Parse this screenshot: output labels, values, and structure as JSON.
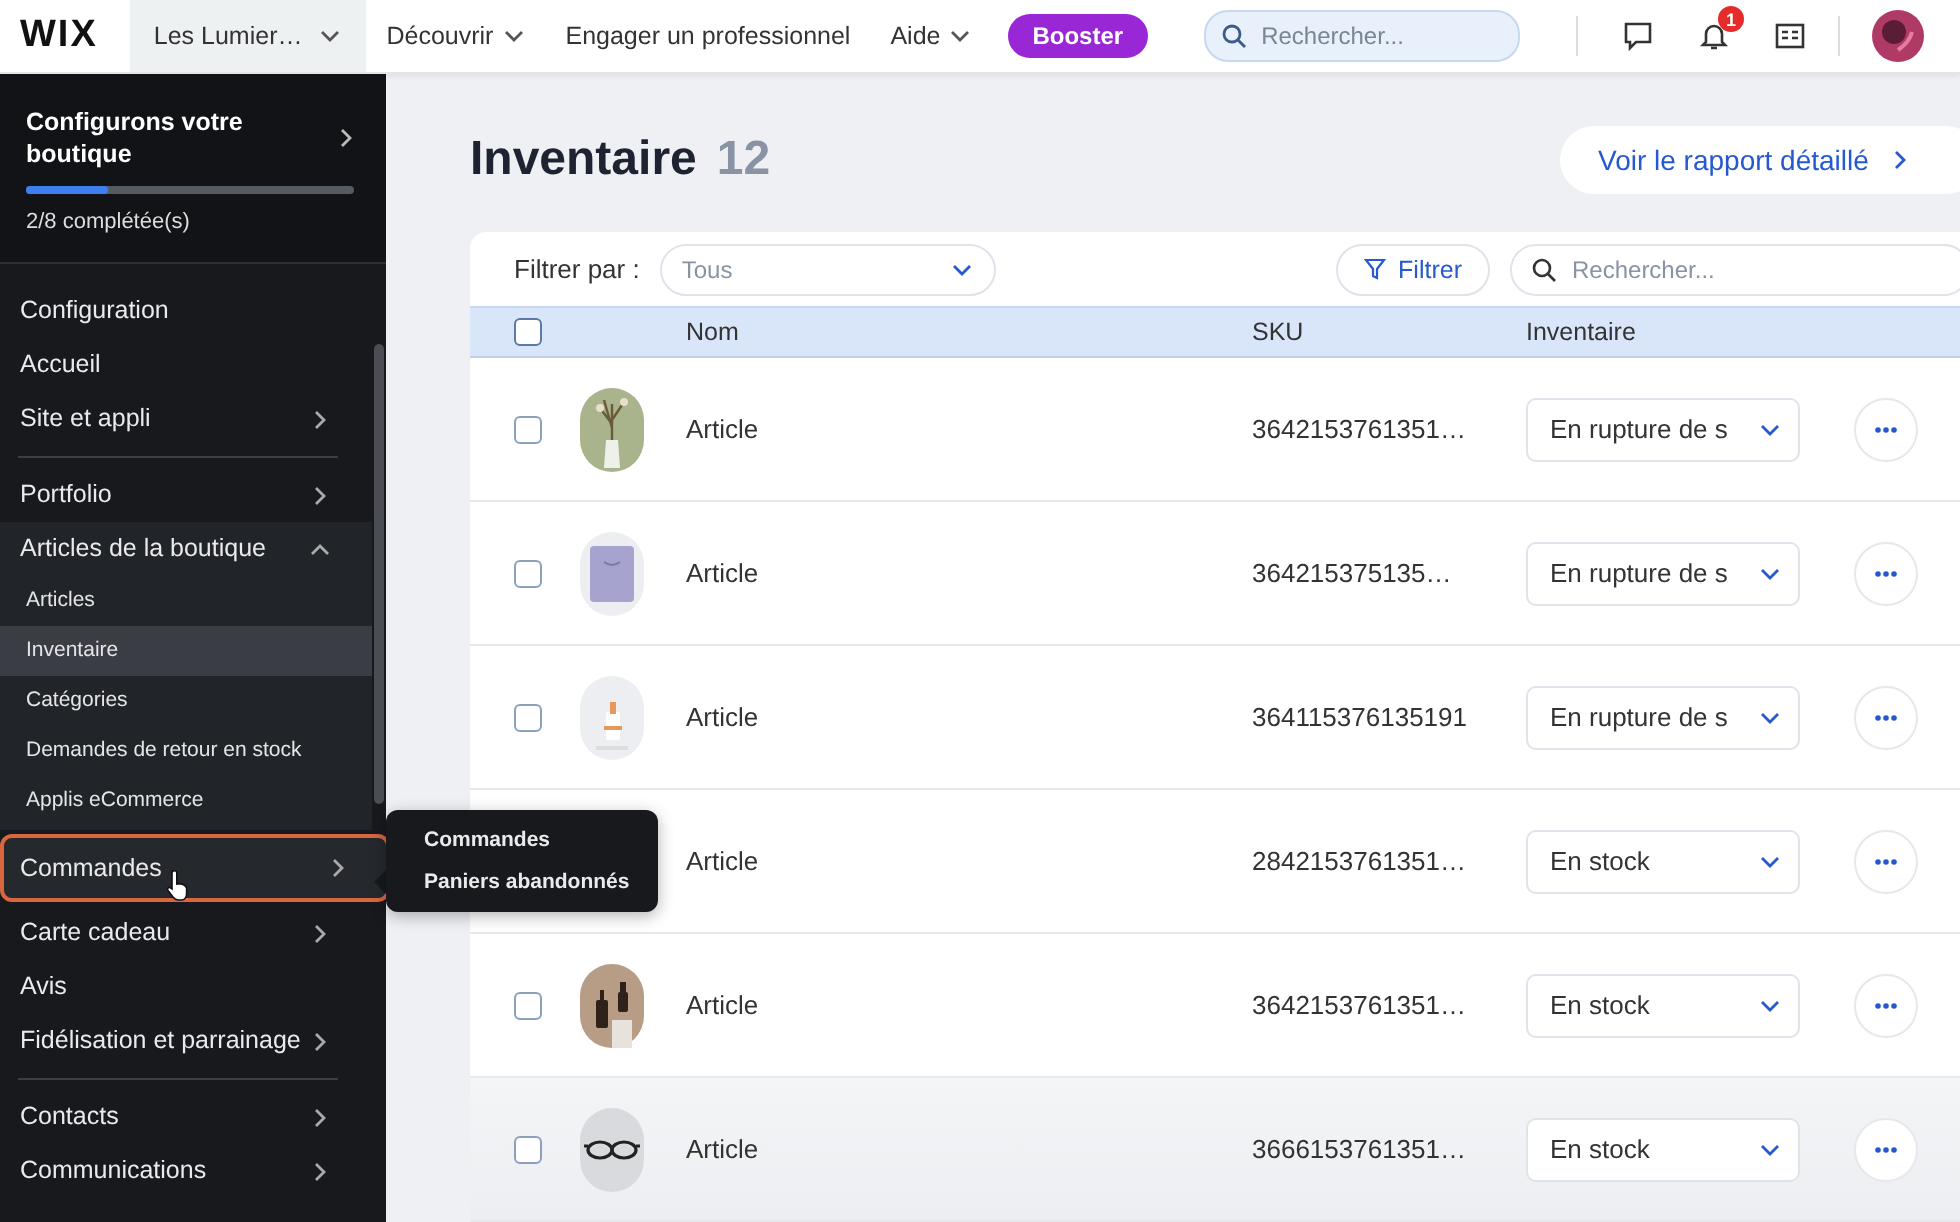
{
  "topbar": {
    "logo": "WIX",
    "site": "Les Lumier…",
    "nav": [
      {
        "label": "Découvrir",
        "caret": true
      },
      {
        "label": "Engager un professionnel",
        "caret": false
      },
      {
        "label": "Aide",
        "caret": true
      }
    ],
    "upgrade": "Booster",
    "search": {
      "placeholder": "Rechercher..."
    },
    "notifications": "1"
  },
  "sidebar": {
    "setup": {
      "title": "Configurons votre boutique",
      "level": 0.25,
      "progress": "2/8 complétée(s)"
    },
    "items": [
      {
        "label": "Configuration",
        "has_submenu": false,
        "divider_after": false,
        "highlighted": false
      },
      {
        "label": "Accueil",
        "has_submenu": false,
        "divider_after": false,
        "highlighted": false
      },
      {
        "label": "Site et appli",
        "has_submenu": true,
        "expanded": false,
        "divider_after": true,
        "highlighted": false
      },
      {
        "label": "Portfolio",
        "has_submenu": true,
        "expanded": false,
        "divider_after": false,
        "highlighted": false
      },
      {
        "label": "Articles de la boutique",
        "has_submenu": true,
        "expanded": true,
        "divider_after": false,
        "highlighted": false,
        "children": [
          {
            "label": "Articles",
            "selected": false
          },
          {
            "label": "Inventaire",
            "selected": true
          },
          {
            "label": "Catégories",
            "selected": false
          },
          {
            "label": "Demandes de retour en stock",
            "selected": false
          },
          {
            "label": "Applis eCommerce",
            "selected": false
          }
        ]
      },
      {
        "label": "Commandes",
        "has_submenu": true,
        "expanded": false,
        "divider_after": false,
        "highlighted": true
      },
      {
        "label": "Carte cadeau",
        "has_submenu": true,
        "expanded": false,
        "divider_after": false,
        "highlighted": false
      },
      {
        "label": "Avis",
        "has_submenu": false,
        "divider_after": false,
        "highlighted": false
      },
      {
        "label": "Fidélisation et parrainage",
        "has_submenu": true,
        "expanded": false,
        "divider_after": true,
        "highlighted": false
      },
      {
        "label": "Contacts",
        "has_submenu": true,
        "expanded": false,
        "divider_after": false,
        "highlighted": false
      },
      {
        "label": "Communications",
        "has_submenu": true,
        "expanded": false,
        "divider_after": false,
        "highlighted": false
      }
    ]
  },
  "flyout": {
    "items": [
      "Commandes",
      "Paniers abandonnés"
    ]
  },
  "page": {
    "title": "Inventaire",
    "count": "12",
    "report_button": "Voir le rapport détaillé"
  },
  "filters": {
    "label": "Filtrer par :",
    "select": "Tous",
    "filter_button": "Filtrer",
    "search": {
      "placeholder": "Rechercher..."
    }
  },
  "table": {
    "columns": [
      "Nom",
      "SKU",
      "Inventaire"
    ],
    "header_checked": false,
    "rows": [
      {
        "checked": false,
        "picture": true,
        "name": "Article",
        "sku": "3642153761351…",
        "inventory": "En rupture de s"
      },
      {
        "checked": false,
        "picture": true,
        "name": "Article",
        "sku": "364215375135…",
        "inventory": "En rupture de s"
      },
      {
        "checked": false,
        "picture": true,
        "name": "Article",
        "sku": "364115376135191",
        "inventory": "En rupture de s"
      },
      {
        "picture": false,
        "name": "Article",
        "sku": "2842153761351…",
        "inventory": "En stock"
      },
      {
        "checked": false,
        "picture": true,
        "name": "Article",
        "sku": "3642153761351…",
        "inventory": "En stock"
      },
      {
        "checked": false,
        "picture": true,
        "name": "Article",
        "sku": "3666153761351…",
        "inventory": "En stock"
      }
    ]
  }
}
